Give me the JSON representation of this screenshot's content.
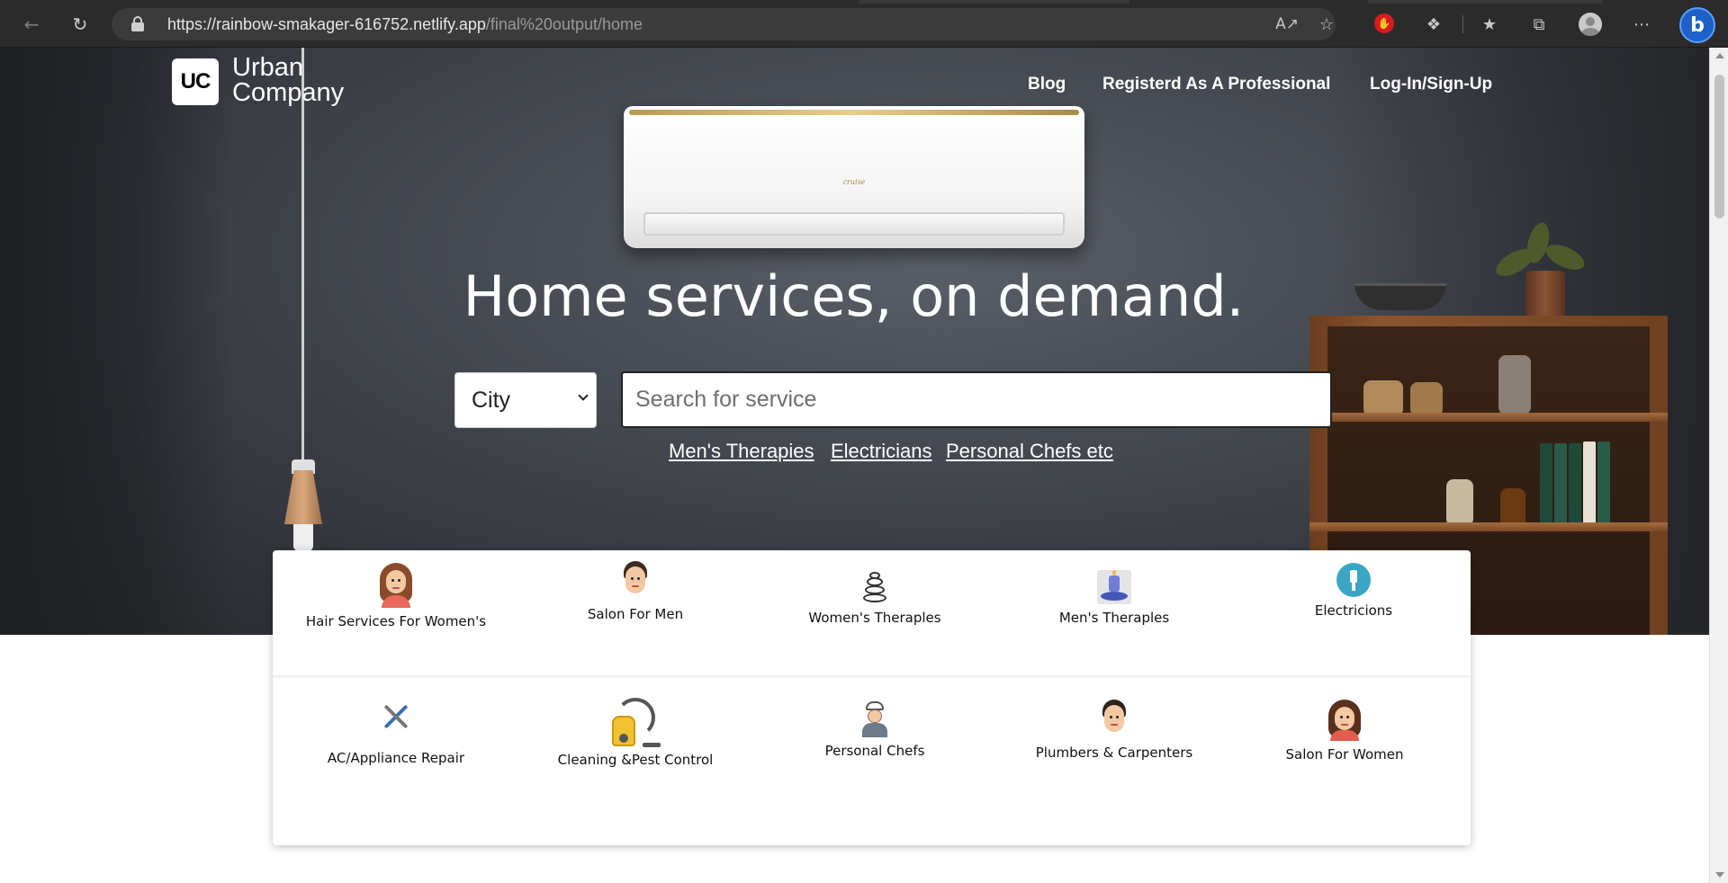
{
  "browser": {
    "url_host": "https://rainbow-smakager-616752.netlify.app",
    "url_path": "/final%20output/home",
    "icons": [
      "back-icon",
      "reload-icon",
      "lock-icon",
      "read-aloud-icon",
      "add-favorite-icon",
      "adblock-extension-icon",
      "extensions-icon",
      "favorites-icon",
      "collections-icon",
      "profile-icon",
      "more-icon",
      "bing-icon"
    ]
  },
  "header": {
    "logo_mark": "UC",
    "logo_line1": "Urban",
    "logo_line2": "Company",
    "nav": {
      "blog": "Blog",
      "professional": "Registerd As A Professional",
      "login": "Log-In/Sign-Up"
    }
  },
  "hero": {
    "headline": "Home services, on demand.",
    "ac_brand": "cruise",
    "city_select": {
      "value": "City"
    },
    "search": {
      "placeholder": "Search for service"
    },
    "quick_links": [
      "Men's Therapies",
      "Electricians",
      "Personal Chefs etc"
    ]
  },
  "services": {
    "row1": [
      {
        "label": "Hair Services For Women's",
        "icon": "woman-face-icon"
      },
      {
        "label": "Salon For Men",
        "icon": "man-face-icon"
      },
      {
        "label": "Women's Theraples",
        "icon": "spa-stones-icon"
      },
      {
        "label": "Men's Theraples",
        "icon": "spa-candle-icon"
      },
      {
        "label": "Electricions",
        "icon": "plug-icon"
      }
    ],
    "row2": [
      {
        "label": "AC/Appliance Repair",
        "icon": "tools-icon"
      },
      {
        "label": "Cleaning &Pest Control",
        "icon": "vacuum-icon"
      },
      {
        "label": "Personal Chefs",
        "icon": "chef-icon"
      },
      {
        "label": "Plumbers & Carpenters",
        "icon": "man-face-icon"
      },
      {
        "label": "Salon For Women",
        "icon": "woman-face-icon"
      }
    ]
  },
  "colors": {
    "chrome_bg": "#2b2b2b",
    "hero_bg": "#464a52",
    "plug_icon": "#3aa6c4",
    "bing": "#1e60c8"
  }
}
